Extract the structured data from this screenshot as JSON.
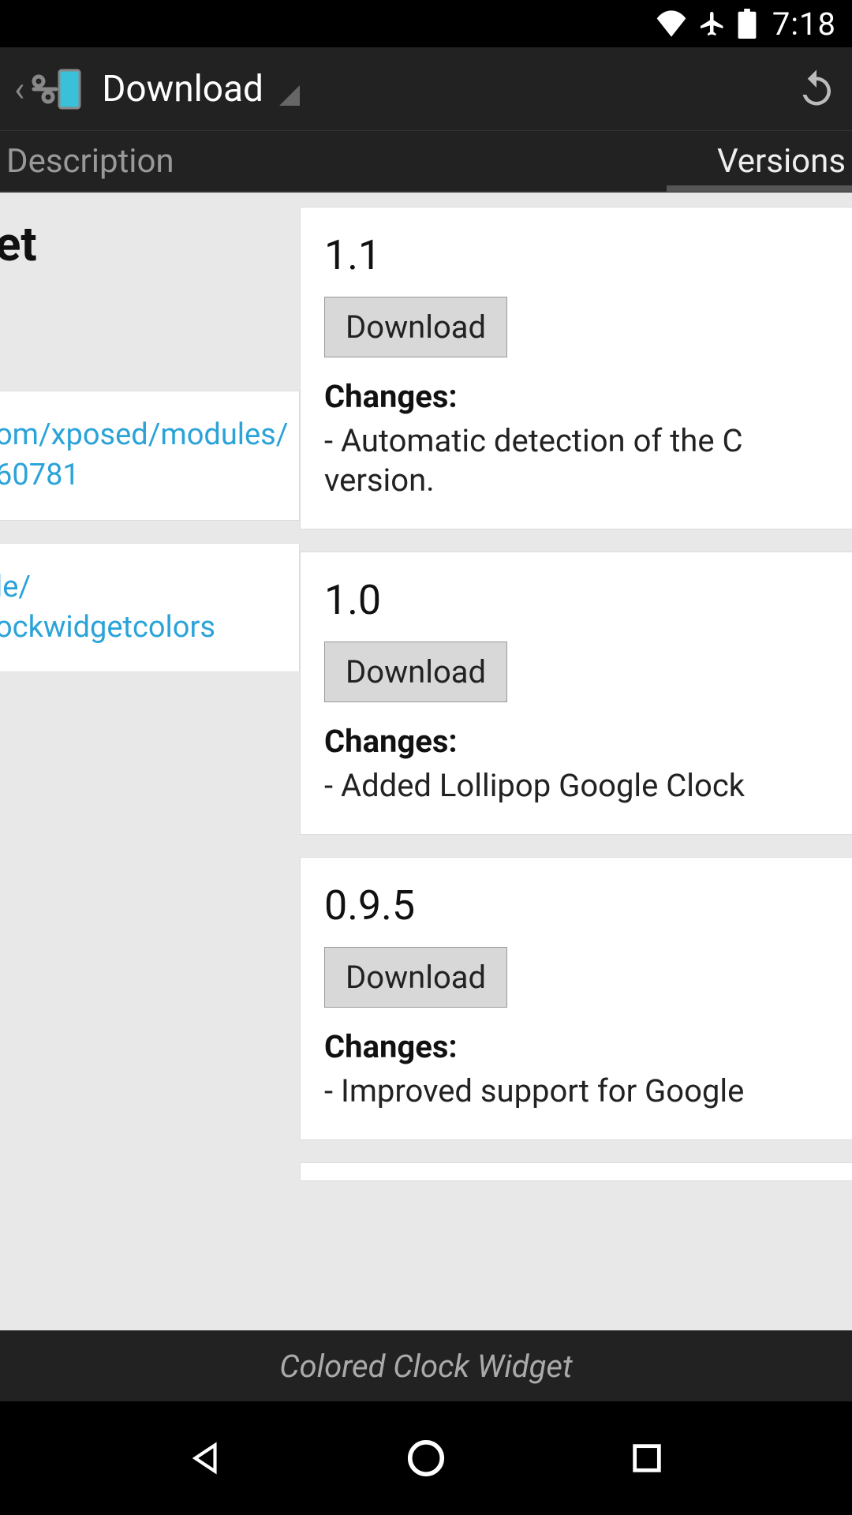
{
  "status": {
    "time": "7:18"
  },
  "action_bar": {
    "title": "Download"
  },
  "tabs": {
    "description": "Description",
    "versions": "Versions",
    "active": "versions"
  },
  "left": {
    "title_fragment": "et",
    "link1_line1": "om/xposed/modules/",
    "link1_line2": "60781",
    "link2_line1": "le/",
    "link2_line2": "ockwidgetcolors"
  },
  "versions": [
    {
      "version": "1.1",
      "button": "Download",
      "changes_label": "Changes:",
      "changes_text": "- Automatic detection of the C\nversion."
    },
    {
      "version": "1.0",
      "button": "Download",
      "changes_label": "Changes:",
      "changes_text": "- Added Lollipop Google Clock"
    },
    {
      "version": "0.9.5",
      "button": "Download",
      "changes_label": "Changes:",
      "changes_text": "- Improved support for Google"
    }
  ],
  "toast": "Colored Clock Widget"
}
